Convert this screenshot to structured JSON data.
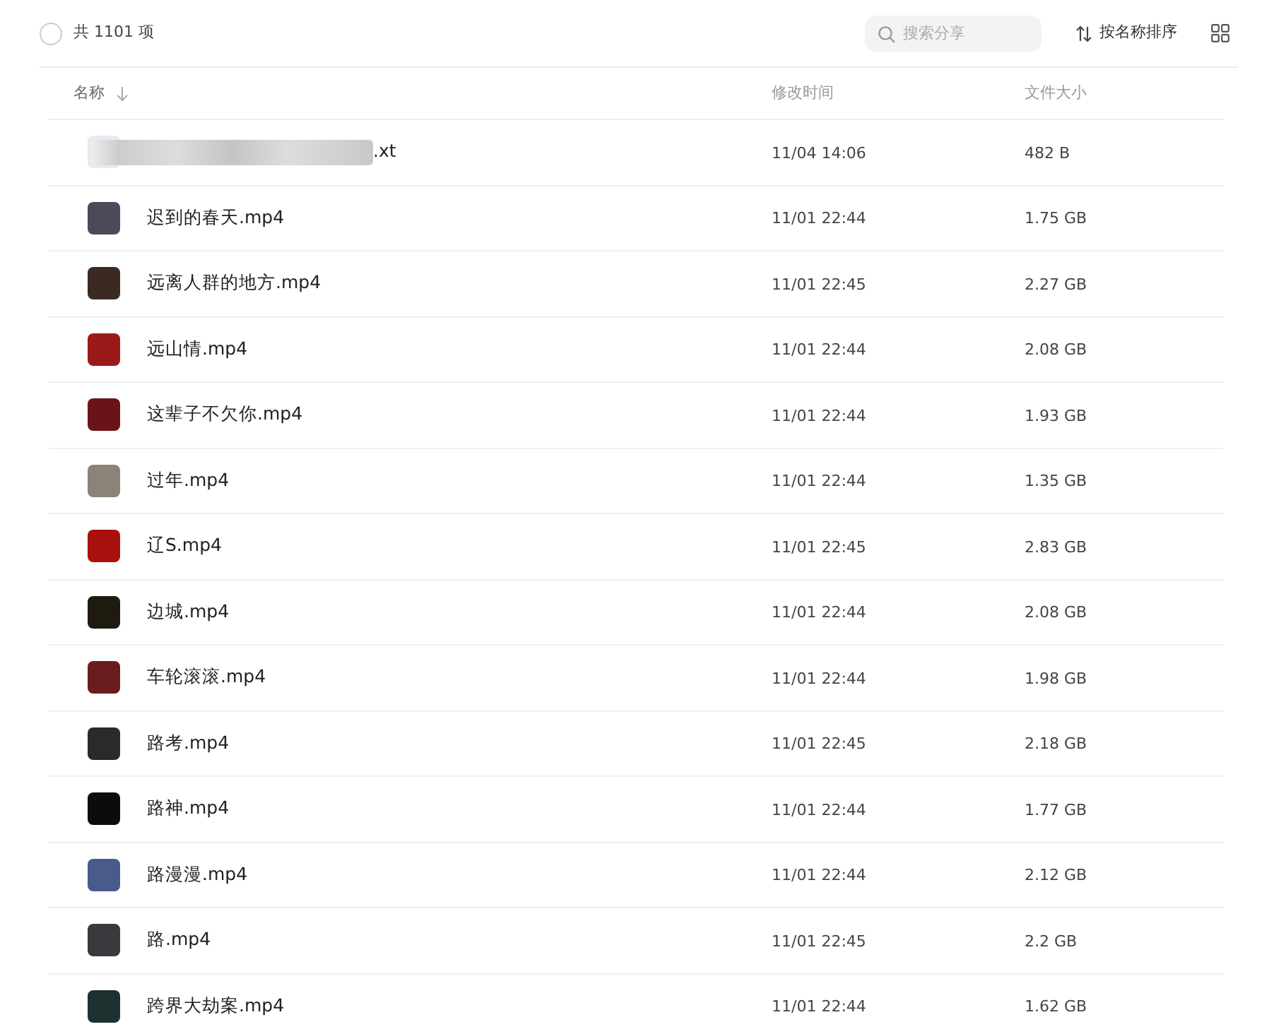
{
  "toolbar": {
    "select_all": {
      "checked": false
    },
    "count": "共 1101 项",
    "search": {
      "placeholder": "搜索分享"
    },
    "sort": "按名称排序"
  },
  "table": {
    "columns": [
      {
        "label": "名称",
        "sorted": true
      },
      {
        "label": "修改时间",
        "sorted": false
      },
      {
        "label": "文件大小",
        "sorted": false
      }
    ],
    "rows": [
      {
        "kind": "redacted",
        "name": ".xt",
        "modified": "11/04 14:06",
        "size": "482 B",
        "color": "#e6eaf2"
      },
      {
        "kind": "video",
        "name": "迟到的春天.mp4",
        "modified": "11/01 22:44",
        "size": "1.75 GB",
        "color": "#4a4a5a"
      },
      {
        "kind": "video",
        "name": "远离人群的地方.mp4",
        "modified": "11/01 22:45",
        "size": "2.27 GB",
        "color": "#3a2a22"
      },
      {
        "kind": "video",
        "name": "远山情.mp4",
        "modified": "11/01 22:44",
        "size": "2.08 GB",
        "color": "#9a1a1a"
      },
      {
        "kind": "video",
        "name": "这辈子不欠你.mp4",
        "modified": "11/01 22:44",
        "size": "1.93 GB",
        "color": "#6a1418"
      },
      {
        "kind": "video",
        "name": "过年.mp4",
        "modified": "11/01 22:44",
        "size": "1.35 GB",
        "color": "#8a8478"
      },
      {
        "kind": "video",
        "name": "辽S.mp4",
        "modified": "11/01 22:45",
        "size": "2.83 GB",
        "color": "#a8100e"
      },
      {
        "kind": "video",
        "name": "边城.mp4",
        "modified": "11/01 22:44",
        "size": "2.08 GB",
        "color": "#1e1a10"
      },
      {
        "kind": "video",
        "name": "车轮滚滚.mp4",
        "modified": "11/01 22:44",
        "size": "1.98 GB",
        "color": "#6a1c1c"
      },
      {
        "kind": "video",
        "name": "路考.mp4",
        "modified": "11/01 22:45",
        "size": "2.18 GB",
        "color": "#2a2a2a"
      },
      {
        "kind": "video",
        "name": "路神.mp4",
        "modified": "11/01 22:44",
        "size": "1.77 GB",
        "color": "#0c0c0c"
      },
      {
        "kind": "video",
        "name": "路漫漫.mp4",
        "modified": "11/01 22:44",
        "size": "2.12 GB",
        "color": "#4a5a8a"
      },
      {
        "kind": "video",
        "name": "路.mp4",
        "modified": "11/01 22:45",
        "size": "2.2 GB",
        "color": "#3a3a3e"
      },
      {
        "kind": "video",
        "name": "跨界大劫案.mp4",
        "modified": "11/01 22:44",
        "size": "1.62 GB",
        "color": "#1e3030"
      }
    ]
  }
}
